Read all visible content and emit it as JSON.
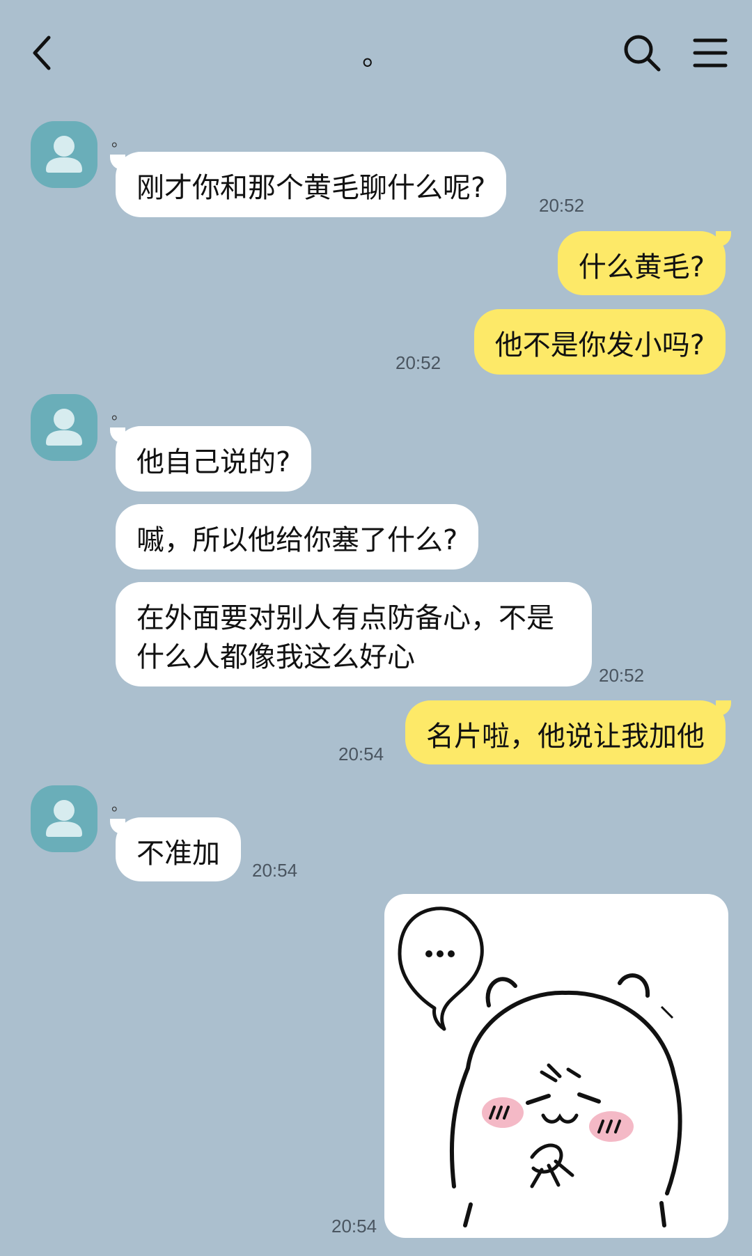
{
  "header": {
    "title": "。",
    "back_icon": "chevron-left-icon",
    "search_icon": "search-icon",
    "menu_icon": "hamburger-menu-icon"
  },
  "contact": {
    "name": "。"
  },
  "messages": [
    {
      "from": "them",
      "text": "刚才你和那个黄毛聊什么呢?",
      "time": "20:52"
    },
    {
      "from": "me",
      "text": "什么黄毛?"
    },
    {
      "from": "me",
      "text": "他不是你发小吗?",
      "time": "20:52"
    },
    {
      "from": "them",
      "text": "他自己说的?"
    },
    {
      "from": "them",
      "text": "嘁，所以他给你塞了什么?"
    },
    {
      "from": "them",
      "text": "在外面要对别人有点防备心，不是什么人都像我这么好心",
      "time": "20:52"
    },
    {
      "from": "me",
      "text": "名片啦，他说让我加他",
      "time": "20:54"
    },
    {
      "from": "them",
      "text": "不准加",
      "time": "20:54"
    },
    {
      "from": "me",
      "type": "sticker",
      "sticker": "grumpy-bear-sticker",
      "time": "20:54"
    }
  ],
  "colors": {
    "background": "#abbfce",
    "incoming_bubble": "#ffffff",
    "outgoing_bubble": "#fde968",
    "avatar": "#6aaeb9"
  }
}
